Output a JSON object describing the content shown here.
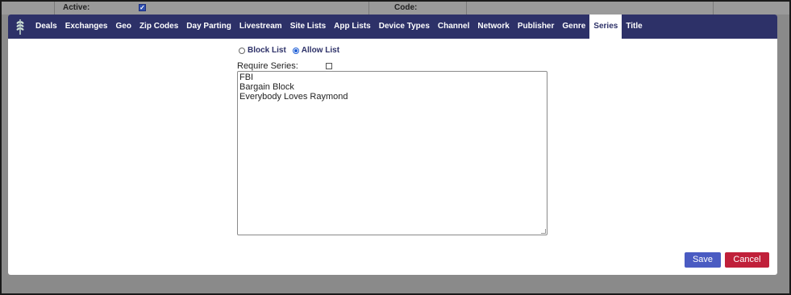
{
  "background": {
    "active_label": "Active:",
    "code_label": "Code:"
  },
  "nav": {
    "tabs": [
      {
        "label": "Deals"
      },
      {
        "label": "Exchanges"
      },
      {
        "label": "Geo"
      },
      {
        "label": "Zip Codes"
      },
      {
        "label": "Day Parting"
      },
      {
        "label": "Livestream"
      },
      {
        "label": "Site Lists"
      },
      {
        "label": "App Lists"
      },
      {
        "label": "Device Types"
      },
      {
        "label": "Channel"
      },
      {
        "label": "Network"
      },
      {
        "label": "Publisher"
      },
      {
        "label": "Genre"
      },
      {
        "label": "Series"
      },
      {
        "label": "Title"
      }
    ],
    "active_tab": "Series"
  },
  "list_mode": {
    "options": [
      "Block List",
      "Allow List"
    ],
    "selected": "Allow List"
  },
  "require_series": {
    "label": "Require Series:",
    "checked": false
  },
  "series_list": {
    "lines": [
      "FBI",
      "Bargain Block",
      "Everybody Loves Raymond"
    ]
  },
  "buttons": {
    "save": "Save",
    "cancel": "Cancel"
  },
  "colors": {
    "navbar": "#2d3168",
    "save": "#4a5bc2",
    "cancel": "#c0203a"
  }
}
